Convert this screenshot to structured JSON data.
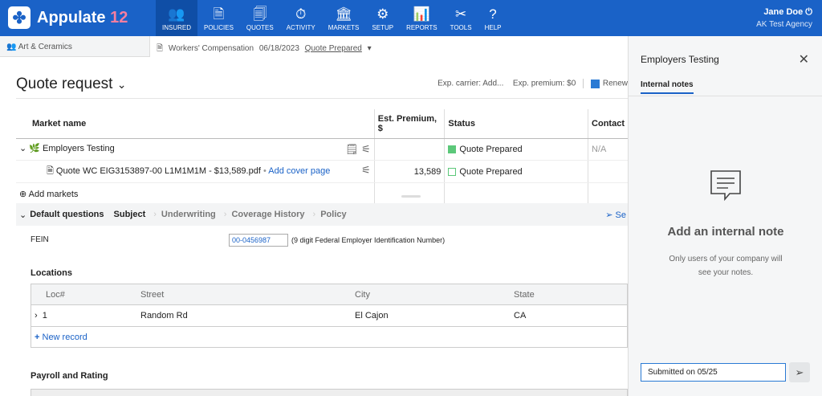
{
  "app": {
    "name": "Appulate",
    "version": "12"
  },
  "nav": [
    {
      "label": "INSURED",
      "icon": "insured-icon"
    },
    {
      "label": "POLICIES",
      "icon": "policies-icon"
    },
    {
      "label": "QUOTES",
      "icon": "quotes-icon"
    },
    {
      "label": "ACTIVITY",
      "icon": "activity-icon"
    },
    {
      "label": "MARKETS",
      "icon": "markets-icon"
    },
    {
      "label": "SETUP",
      "icon": "setup-icon"
    },
    {
      "label": "REPORTS",
      "icon": "reports-icon"
    },
    {
      "label": "TOOLS",
      "icon": "tools-icon"
    },
    {
      "label": "HELP",
      "icon": "help-icon"
    }
  ],
  "user": {
    "name": "Jane Doe",
    "agency": "AK Test Agency"
  },
  "subbar": {
    "insured": "Art & Ceramics",
    "policy": "Workers' Compensation",
    "date": "06/18/2023",
    "status": "Quote Prepared"
  },
  "page": {
    "title": "Quote request",
    "exp_carrier": "Exp. carrier: Add...",
    "exp_premium": "Exp. premium: $0",
    "renew": "Renew"
  },
  "markets_table": {
    "headers": [
      "Market name",
      "Est. Premium, $",
      "Status",
      "Contact"
    ],
    "market": {
      "name": "Employers Testing",
      "status": "Quote Prepared",
      "contact": "N/A"
    },
    "quote": {
      "file": "Quote WC EIG3153897-00 L1M1M1M - $13,589.pdf",
      "cover": "Add cover page",
      "premium": "13,589",
      "status": "Quote Prepared"
    },
    "add_markets": "Add markets"
  },
  "questions": {
    "label": "Default questions",
    "tabs": [
      "Subject",
      "Underwriting",
      "Coverage History",
      "Policy"
    ],
    "send": "Se"
  },
  "fein": {
    "label": "FEIN",
    "value": "00-0456987",
    "note": "(9 digit Federal Employer Identification Number)"
  },
  "locations": {
    "title": "Locations",
    "headers": [
      "Loc#",
      "Street",
      "City",
      "State"
    ],
    "rows": [
      {
        "loc": "1",
        "street": "Random Rd",
        "city": "El Cajon",
        "state": "CA"
      }
    ],
    "new_record": "New record"
  },
  "payroll": {
    "title": "Payroll and Rating"
  },
  "panel": {
    "title": "Employers Testing",
    "tab": "Internal notes",
    "empty_title": "Add an internal note",
    "empty_desc": "Only users of your company will see your notes.",
    "input_value": "Submitted on 05/25"
  },
  "colors": {
    "brand": "#1a62c7",
    "status_green": "#5cc87a"
  }
}
